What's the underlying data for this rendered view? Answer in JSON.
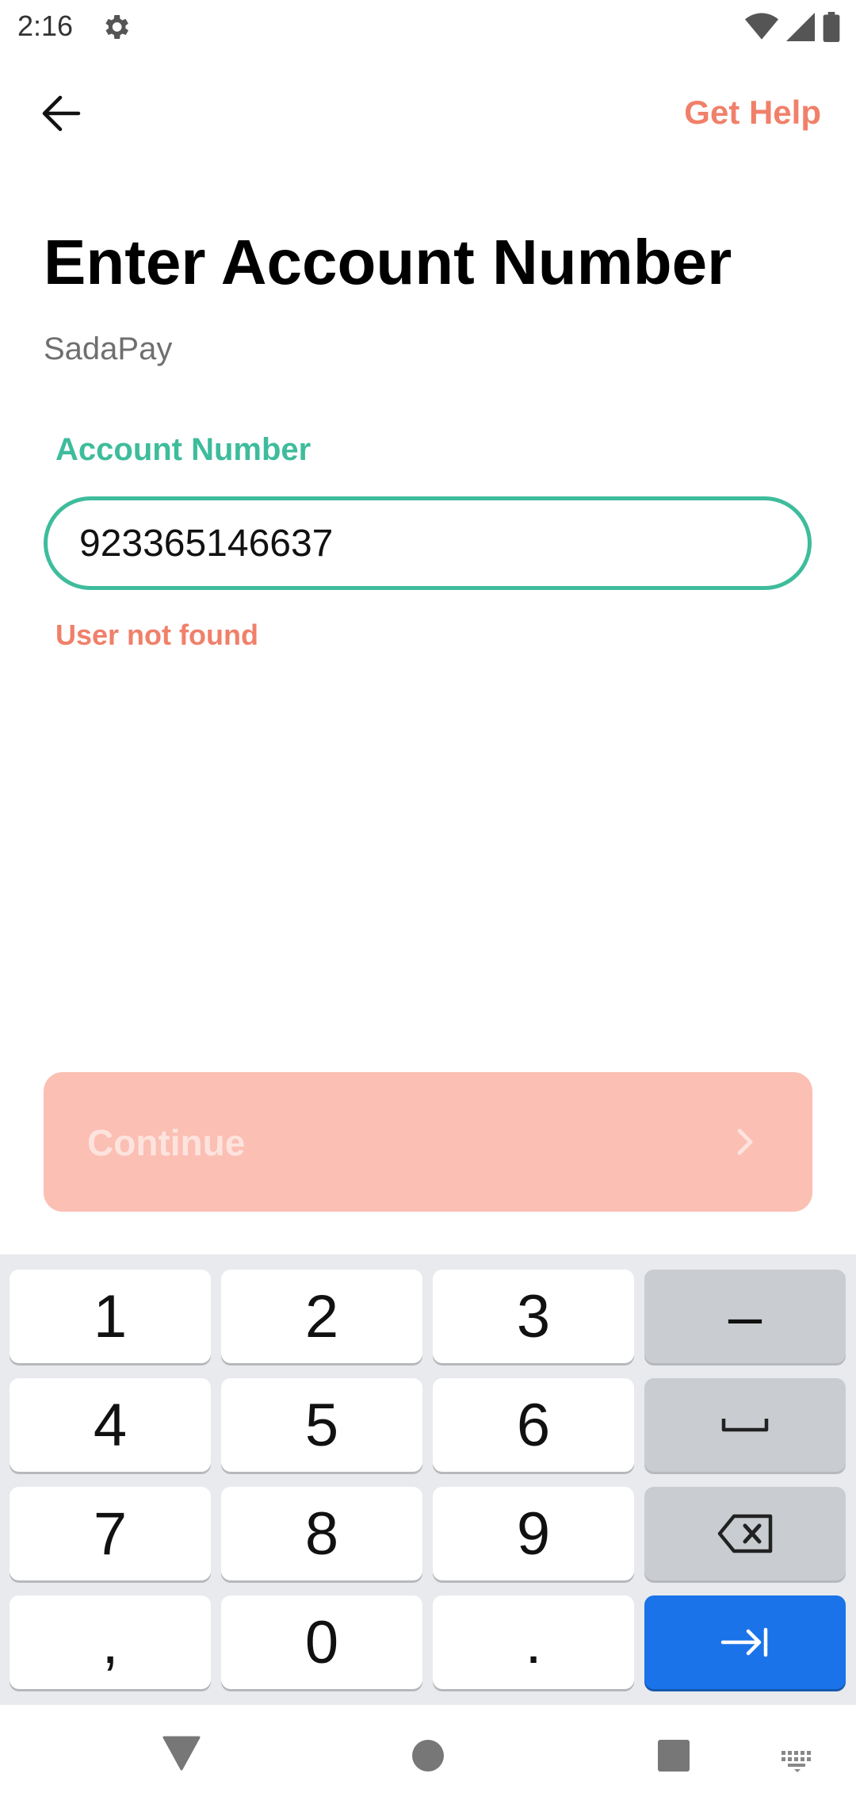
{
  "status_bar": {
    "time": "2:16",
    "icons": [
      "settings-gear-icon",
      "wifi-icon",
      "cellular-signal-icon",
      "battery-icon"
    ]
  },
  "header": {
    "back_icon": "arrow-left-icon",
    "help_label": "Get Help"
  },
  "main": {
    "title": "Enter Account Number",
    "subtitle": "SadaPay",
    "field_label": "Account Number",
    "account_number_value": "923365146637",
    "error_message": "User not found",
    "continue_label": "Continue",
    "continue_icon": "chevron-right-icon"
  },
  "keyboard": {
    "rows": [
      [
        "1",
        "2",
        "3",
        "-"
      ],
      [
        "4",
        "5",
        "6",
        "space"
      ],
      [
        "7",
        "8",
        "9",
        "backspace"
      ],
      [
        ",",
        "0",
        ".",
        "next"
      ]
    ],
    "labels": {
      "k1": "1",
      "k2": "2",
      "k3": "3",
      "dash": "–",
      "k4": "4",
      "k5": "5",
      "k6": "6",
      "k7": "7",
      "k8": "8",
      "k9": "9",
      "comma": ",",
      "k0": "0",
      "period": "."
    }
  },
  "colors": {
    "accent_green": "#3ebc9c",
    "accent_coral": "#f0806a",
    "continue_disabled_bg": "#fbbfb4",
    "enter_key_blue": "#1a73e8"
  },
  "nav_bar": {
    "icons": [
      "back-triangle-icon",
      "home-circle-icon",
      "recents-square-icon",
      "keyboard-switch-icon"
    ]
  }
}
